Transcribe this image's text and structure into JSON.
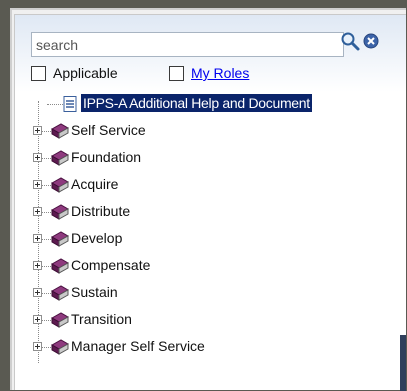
{
  "search": {
    "placeholder": "search",
    "value": ""
  },
  "filters": {
    "applicable_label": "Applicable",
    "applicable_checked": false,
    "my_roles_label": "My Roles",
    "my_roles_checked": false
  },
  "tree": {
    "items": [
      {
        "label": "IPPS-A Additional Help and Document",
        "icon": "document-icon",
        "selected": true
      },
      {
        "label": "Self Service",
        "icon": "book-icon"
      },
      {
        "label": "Foundation",
        "icon": "book-icon"
      },
      {
        "label": "Acquire",
        "icon": "book-icon"
      },
      {
        "label": "Distribute",
        "icon": "book-icon"
      },
      {
        "label": "Develop",
        "icon": "book-icon"
      },
      {
        "label": "Compensate",
        "icon": "book-icon"
      },
      {
        "label": "Sustain",
        "icon": "book-icon"
      },
      {
        "label": "Transition",
        "icon": "book-icon"
      },
      {
        "label": "Manager Self Service",
        "icon": "book-icon"
      }
    ]
  },
  "colors": {
    "selection": "#0a246a",
    "link": "#0000ee",
    "book": "#6b1f5e"
  }
}
